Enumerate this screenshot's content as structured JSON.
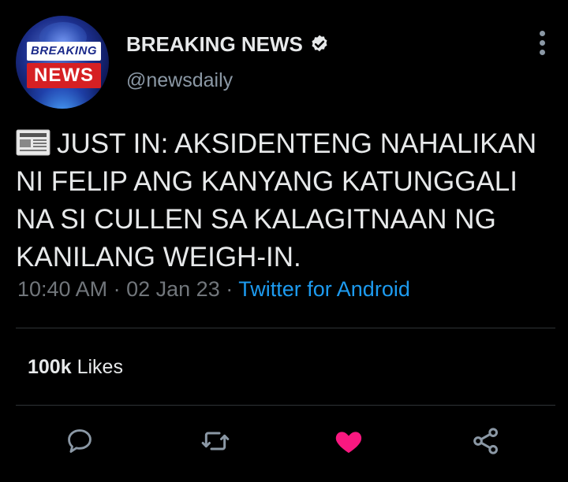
{
  "author": {
    "display_name": "BREAKING NEWS",
    "handle": "@newsdaily",
    "avatar_text_top": "BREAKING",
    "avatar_text_bottom": "NEWS",
    "verified": true
  },
  "tweet": {
    "emoji": "newspaper-icon",
    "text": "JUST IN: AKSIDENTENG NAHALIKAN NI FELIP ANG KANYANG KATUNGGALI NA SI CULLEN SA KALAGITNAAN NG KANILANG WEIGH-IN.",
    "time": "10:40 AM",
    "date": "02 Jan 23",
    "source": "Twitter for Android",
    "meta_separator": "·"
  },
  "stats": {
    "likes_count": "100k",
    "likes_label": "Likes"
  },
  "actions": {
    "reply_icon": "reply-icon",
    "retweet_icon": "retweet-icon",
    "like_icon": "heart-icon",
    "share_icon": "share-icon",
    "liked": true
  },
  "colors": {
    "background": "#000000",
    "accent": "#1d9bf0",
    "like": "#f91880",
    "muted": "#71767b"
  }
}
